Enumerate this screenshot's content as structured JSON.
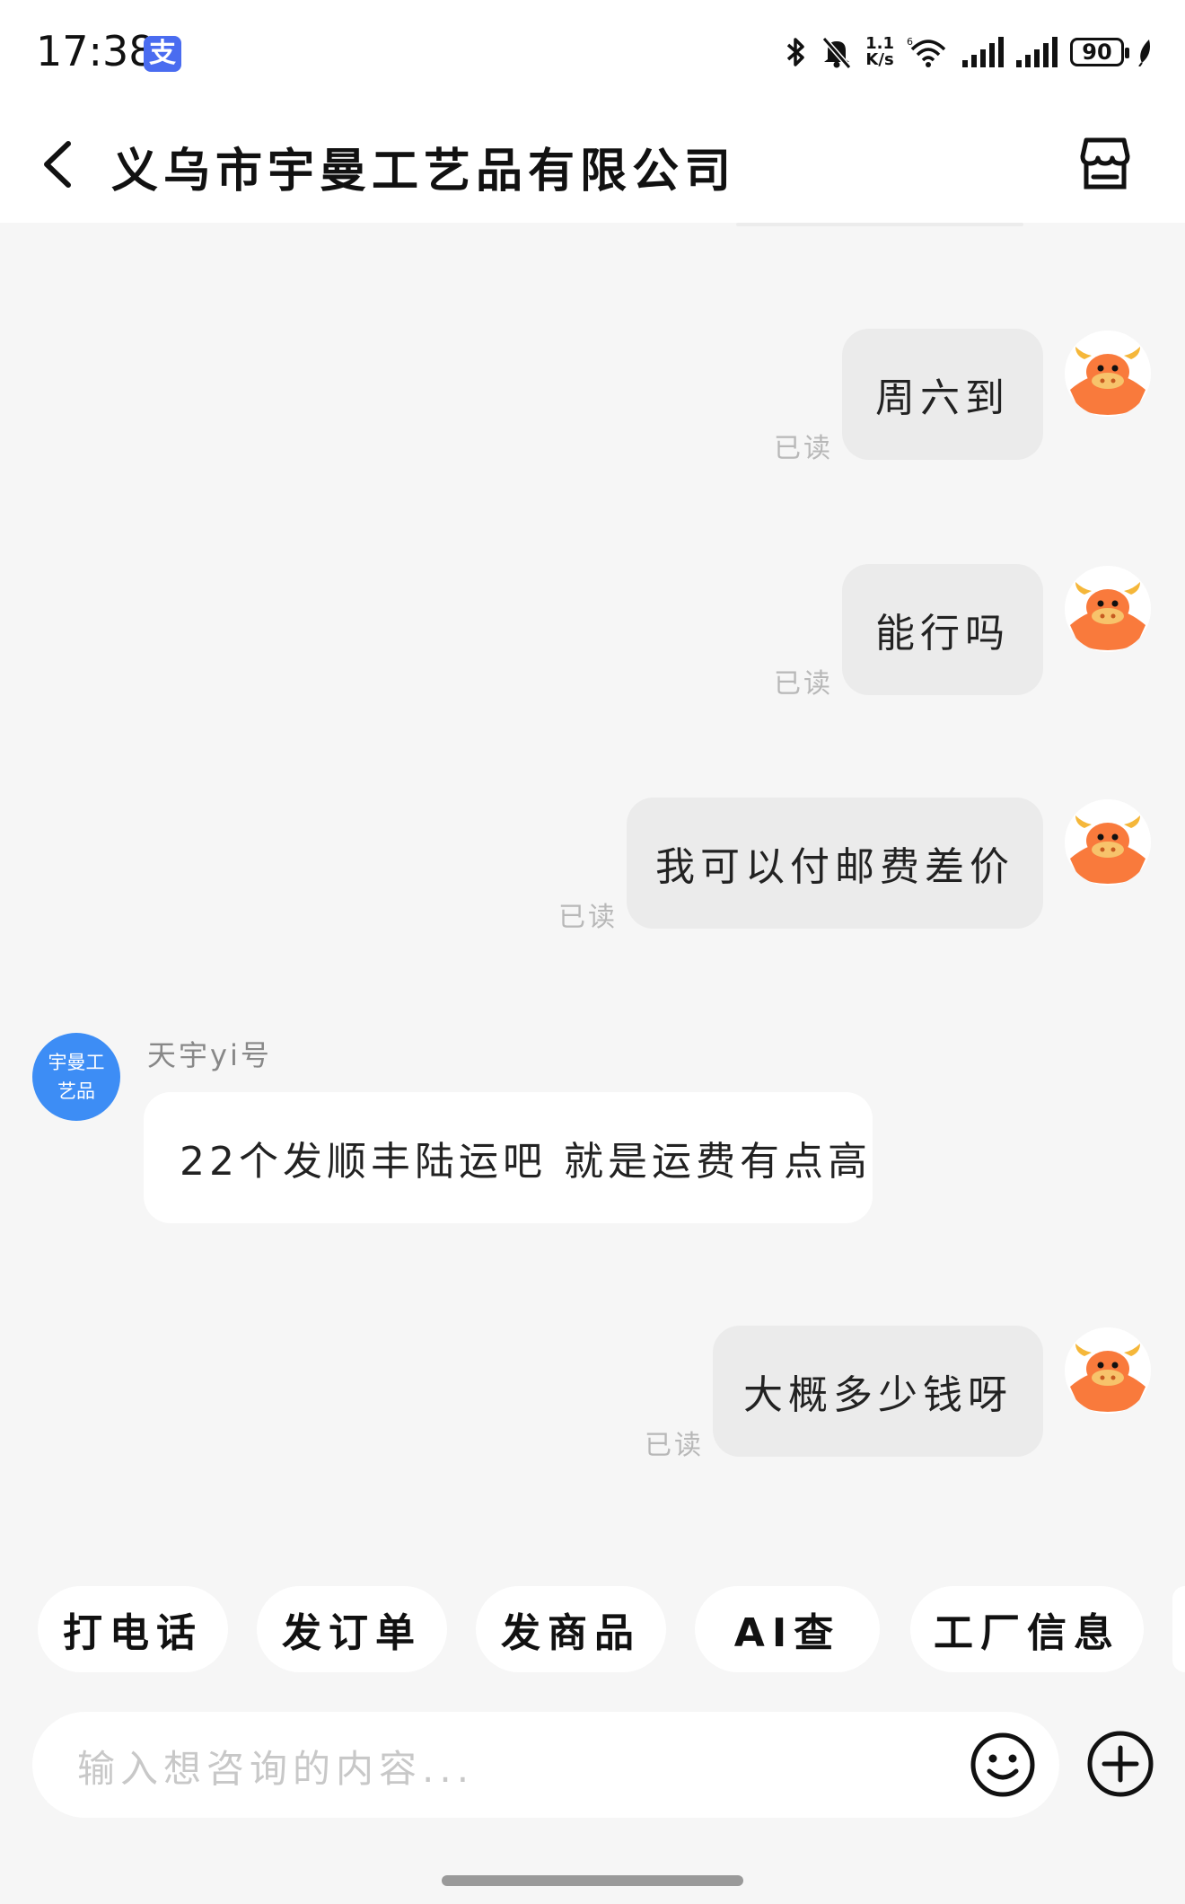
{
  "status_bar": {
    "time": "17:38",
    "alipay_badge": "支",
    "net_speed_top": "1.1",
    "net_speed_bottom": "K/s",
    "battery": "90"
  },
  "header": {
    "title": "义乌市宇曼工艺品有限公司",
    "back_icon": "chevron-left-icon",
    "store_icon": "store-icon"
  },
  "messages": [
    {
      "side": "right",
      "text": "周六到",
      "status": "已读"
    },
    {
      "side": "right",
      "text": "能行吗",
      "status": "已读"
    },
    {
      "side": "right",
      "text": "我可以付邮费差价",
      "status": "已读"
    },
    {
      "side": "left",
      "sender": "天宇yi号",
      "avatar_line1": "宇曼工",
      "avatar_line2": "艺品",
      "text": "22个发顺丰陆运吧 就是运费有点高"
    },
    {
      "side": "right",
      "text": "大概多少钱呀",
      "status": "已读"
    }
  ],
  "quick_actions": [
    "打电话",
    "发订单",
    "发商品",
    "AI查",
    "工厂信息"
  ],
  "composer": {
    "placeholder": "输入想咨询的内容...",
    "emoji_icon": "smiley-icon",
    "plus_icon": "plus-circle-icon"
  },
  "colors": {
    "avatar_orange": "#f97a3c",
    "shop_avatar_blue": "#3d8df5",
    "bubble_gray": "#ebebeb",
    "background": "#f6f6f6"
  }
}
